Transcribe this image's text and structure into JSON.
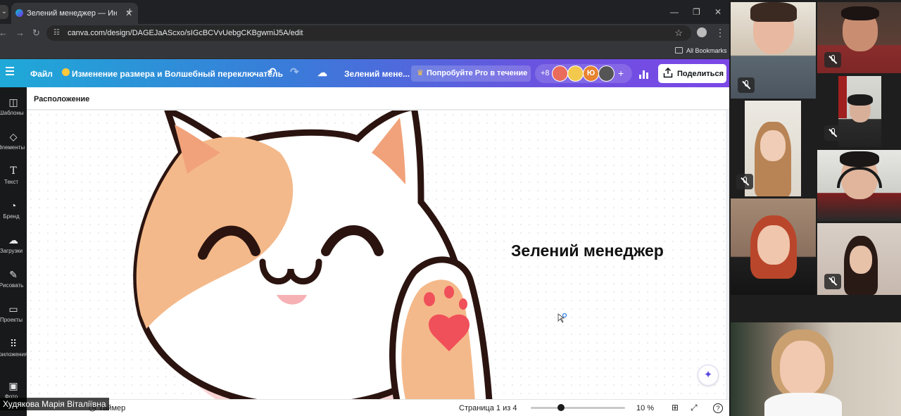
{
  "browser": {
    "tab_title": "Зелений менеджер — Интера",
    "url": "canva.com/design/DAGEJaAScxo/sIGcBCVvUebgCKBgwmiJ5A/edit",
    "bookmarks_label": "All Bookmarks"
  },
  "canva": {
    "file_label": "Файл",
    "resize_label": "Изменение размера и Волшебный переключатель",
    "design_name": "Зелений мене...",
    "pro_label": "Попробуйте Pro в течение ...",
    "collaborator_count": "+8",
    "avatar_initial": "Ю",
    "share_label": "Поделиться"
  },
  "sidebar": {
    "items": [
      {
        "label": "Шаблоны",
        "icon": "templates-icon"
      },
      {
        "label": "Элементы",
        "icon": "elements-icon"
      },
      {
        "label": "Текст",
        "icon": "text-icon"
      },
      {
        "label": "Бренд",
        "icon": "brand-icon"
      },
      {
        "label": "Загрузки",
        "icon": "uploads-icon"
      },
      {
        "label": "Рисовать",
        "icon": "draw-icon"
      },
      {
        "label": "Проекты",
        "icon": "projects-icon"
      },
      {
        "label": "Приложения",
        "icon": "apps-icon"
      },
      {
        "label": "Фото",
        "icon": "photos-icon"
      }
    ]
  },
  "editor": {
    "section_label": "Расположение",
    "slide_title": "Зелений менеджер"
  },
  "footer": {
    "timer_label": "Таймер",
    "page_indicator": "Страница 1 из 4",
    "zoom_level": "10 %",
    "zoom_fraction": 0.32
  },
  "presenter_name": "Худякова Марія Віталіївна",
  "participants": [
    {
      "name": "participant-1",
      "muted": true
    },
    {
      "name": "participant-2",
      "muted": true
    },
    {
      "name": "participant-3",
      "muted": true
    },
    {
      "name": "participant-4",
      "muted": true
    },
    {
      "name": "participant-5",
      "muted": true
    },
    {
      "name": "participant-6",
      "muted": false
    },
    {
      "name": "participant-7",
      "muted": false
    },
    {
      "name": "participant-8",
      "muted": true
    },
    {
      "name": "participant-9",
      "muted": false
    }
  ],
  "colors": {
    "canva_gradient_start": "#1fa9d8",
    "canva_gradient_end": "#7b47e6",
    "sidebar_bg": "#18191b",
    "cat_orange": "#f4b98a",
    "cat_outline": "#2b1410",
    "paw_heart": "#f0505a"
  }
}
